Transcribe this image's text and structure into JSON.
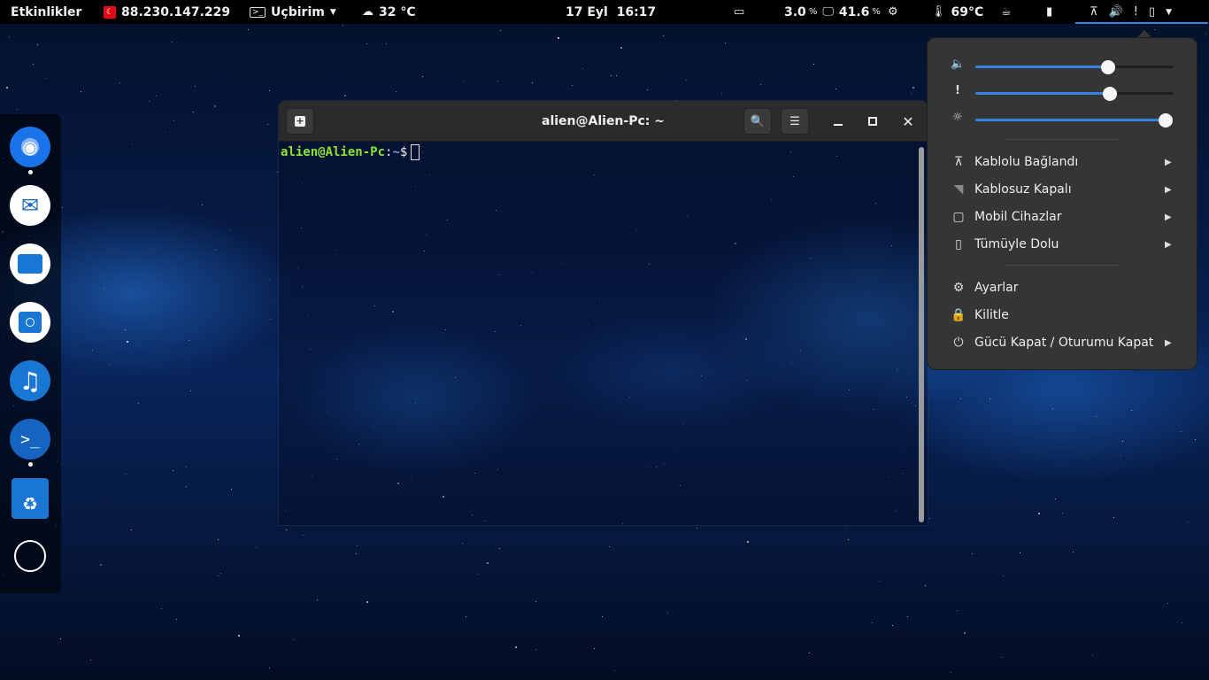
{
  "topbar": {
    "activities": "Etkinlikler",
    "ip": "88.230.147.229",
    "app_menu": "Uçbirim",
    "weather_temp": "32 °C",
    "datetime": "17 Eyl  16:17",
    "cpu_value": "3.0",
    "cpu_unit": "%",
    "mem_value": "41.6",
    "mem_unit": "%",
    "cpu_temp": "69°C"
  },
  "dock": {
    "apps": [
      "chrome-icon",
      "mail-icon",
      "files-icon",
      "software-store-icon",
      "music-icon",
      "terminal-icon",
      "trash-icon"
    ]
  },
  "terminal": {
    "title": "alien@Alien-Pc: ~",
    "prompt_user": "alien@Alien-Pc",
    "prompt_sep": ":",
    "prompt_path": "~",
    "prompt_symbol": "$"
  },
  "system_menu": {
    "volume_level": 0.67,
    "mic_level": 0.68,
    "brightness_level": 0.96,
    "items": [
      {
        "label": "Kablolu Bağlandı",
        "icon": "wired-network-icon"
      },
      {
        "label": "Kablosuz Kapalı",
        "icon": "wireless-icon"
      },
      {
        "label": "Mobil Cihazlar",
        "icon": "mobile-devices-icon"
      },
      {
        "label": "Tümüyle Dolu",
        "icon": "battery-icon"
      }
    ],
    "settings_label": "Ayarlar",
    "lock_label": "Kilitle",
    "power_label": "Gücü Kapat / Oturumu Kapat"
  },
  "colors": {
    "accent": "#3584e4",
    "prompt_user": "#8ae234",
    "prompt_path": "#729fcf",
    "panel_bg": "#353535"
  }
}
